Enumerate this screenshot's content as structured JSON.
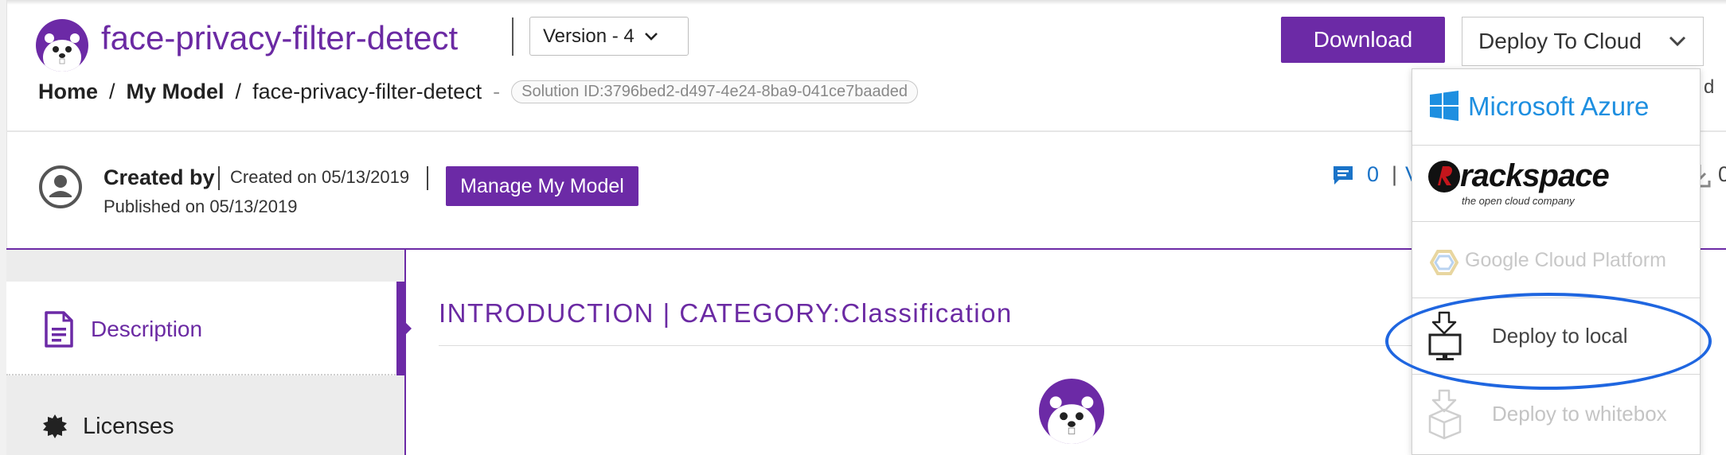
{
  "header": {
    "title": "face-privacy-filter-detect",
    "version_label": "Version - 4"
  },
  "breadcrumb": {
    "home": "Home",
    "sep1": "/",
    "my_model": "My Model",
    "sep2": "/",
    "current": "face-privacy-filter-detect",
    "dash": "-",
    "solution_id": "Solution ID:3796bed2-d497-4e24-8ba9-041ce7baaded"
  },
  "actions": {
    "download_label": "Download",
    "deploy_label": "Deploy To Cloud",
    "edge_text": "d"
  },
  "meta": {
    "created_by_label": "Created by",
    "created_on": "Created on 05/13/2019",
    "published_on": "Published on 05/13/2019",
    "manage_label": "Manage My Model",
    "comment_count": "0",
    "comment_sep": "|",
    "comment_next": "V",
    "download_count": "0"
  },
  "sidenav": {
    "items": [
      {
        "label": "Description",
        "active": true
      },
      {
        "label": "Licenses",
        "active": false
      }
    ]
  },
  "content": {
    "heading": "INTRODUCTION | CATEGORY:Classification"
  },
  "deploy_menu": {
    "items": [
      {
        "label": "Microsoft Azure",
        "enabled": true
      },
      {
        "label": "rackspace",
        "sub": "the open cloud company",
        "enabled": true
      },
      {
        "label": "Google Cloud Platform",
        "enabled": false
      },
      {
        "label": "Deploy to local",
        "enabled": true,
        "highlighted": true
      },
      {
        "label": "Deploy to whitebox",
        "enabled": false
      }
    ]
  },
  "colors": {
    "brand": "#6c2aa6",
    "link": "#1a73c8",
    "highlight": "#1f66e0"
  }
}
